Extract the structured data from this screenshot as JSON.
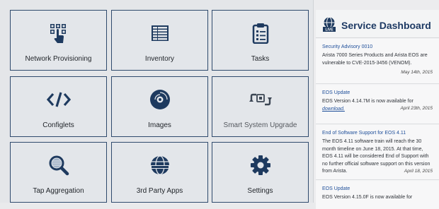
{
  "tiles": [
    {
      "label": "Network Provisioning",
      "icon": "network-provisioning-icon"
    },
    {
      "label": "Inventory",
      "icon": "inventory-icon"
    },
    {
      "label": "Tasks",
      "icon": "tasks-clipboard-icon"
    },
    {
      "label": "Configlets",
      "icon": "code-brackets-icon"
    },
    {
      "label": "Images",
      "icon": "disc-icon"
    },
    {
      "label": "Smart System Upgrade",
      "icon": "upgrade-arrows-icon"
    },
    {
      "label": "Tap Aggregation",
      "icon": "magnifier-icon"
    },
    {
      "label": "3rd Party Apps",
      "icon": "globe-apps-icon"
    },
    {
      "label": "Settings",
      "icon": "gear-icon"
    }
  ],
  "dashboard": {
    "badge": "LIVE",
    "title": "Service Dashboard",
    "news": [
      {
        "title": "Security Advisory 0010",
        "body": "Arista 7000 Series Products and Arista EOS are vulnerable to CVE-2015-3456 (VENOM).",
        "date": "May 14th, 2015"
      },
      {
        "title": "EOS Update",
        "body": "EOS Version 4.14.7M is now available for",
        "link": "download.",
        "date": "April 23th, 2015"
      },
      {
        "title": "End of Software Support for EOS 4.11",
        "body": "The EOS 4.11 software train will reach the 30 month timeline on June 18, 2015. At that time, EOS 4.11 will be considered End of Support with no further official software support on this version from Arista.",
        "date": "April 18, 2015"
      },
      {
        "title": "EOS Update",
        "body": "EOS Version 4.15.0F is now available for"
      }
    ]
  },
  "colors": {
    "icon": "#1e3a5f",
    "border": "#2f4a6d",
    "link": "#1f4f9a",
    "title": "#1e3a64"
  }
}
